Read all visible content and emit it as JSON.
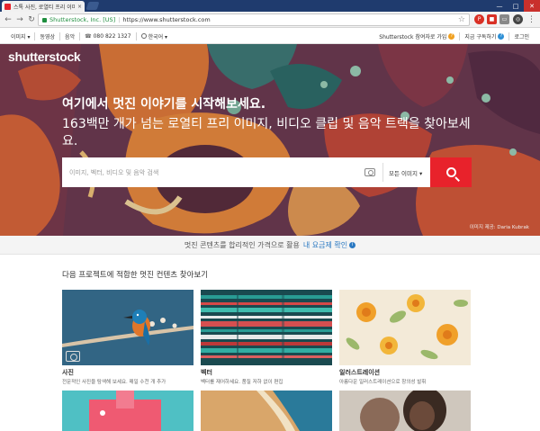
{
  "browser": {
    "tab_title": "스톡 사진, 로열티 프리 이미지, 벡...",
    "tab_close": "×",
    "secure_label": "Shutterstock, Inc. [US]",
    "url": "https://www.shutterstock.com"
  },
  "util_bar": {
    "images": "이미지 ▾",
    "video": "동영상",
    "music": "음악",
    "phone": "080 822 1327",
    "language": "한국어 ▾",
    "why_join": "Shutterstock 참여자로 가입",
    "subscribe": "지금 구독하기",
    "login": "로그인"
  },
  "hero": {
    "logo": "shutterstock",
    "headline": "여기에서 멋진 이야기를 시작해보세요.",
    "subheadline": "163백만 개가 넘는 로열티 프리 이미지, 비디오 클립 및 음악 트랙을 찾아보세요.",
    "search_placeholder": "이미지, 벡터, 비디오 및 음악 검색",
    "search_type": "모든 이미지 ▾",
    "credit": "이미지 제공: Daria Kubrak"
  },
  "promo": {
    "text": "멋진 콘텐츠를 합리적인 가격으로 활용",
    "link": "내 요금제 확인",
    "icon": "i"
  },
  "content": {
    "section_title": "다음 프로젝트에 적합한 멋진 컨텐츠 찾아보기",
    "cards": [
      {
        "title": "사진",
        "desc": "전문적인 사진을 탐색해 보세요. 매일 수천 개 추가"
      },
      {
        "title": "벡터",
        "desc": "벡터를 재어하세요. 품질 저하 없이 편집"
      },
      {
        "title": "일러스트레이션",
        "desc": "아름다운 일러스트레이션으로 창의성 발휘"
      }
    ]
  },
  "colors": {
    "brand_red": "#e8222b",
    "link_blue": "#2b79c2"
  }
}
